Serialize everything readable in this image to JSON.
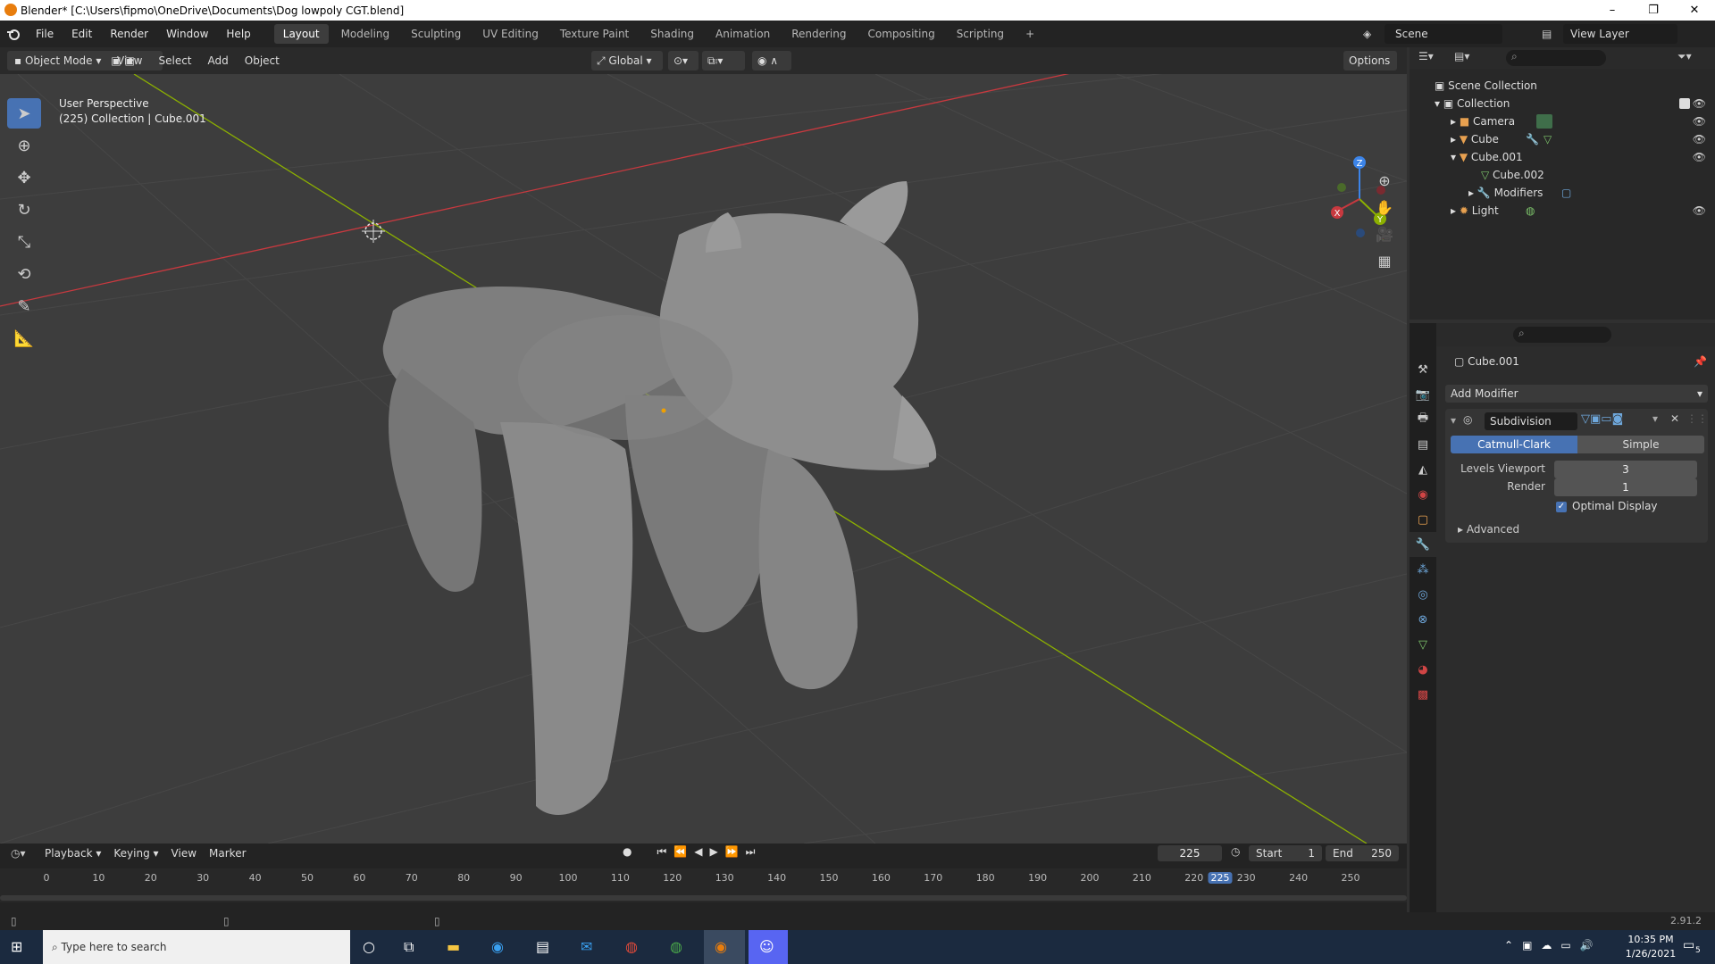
{
  "window": {
    "title": "Blender* [C:\\Users\\fipmo\\OneDrive\\Documents\\Dog lowpoly CGT.blend]",
    "minimize": "–",
    "restore": "❐",
    "close": "✕"
  },
  "menubar": {
    "items": [
      "File",
      "Edit",
      "Render",
      "Window",
      "Help"
    ],
    "workspaces": [
      "Layout",
      "Modeling",
      "Sculpting",
      "UV Editing",
      "Texture Paint",
      "Shading",
      "Animation",
      "Rendering",
      "Compositing",
      "Scripting"
    ],
    "active_workspace": "Layout",
    "add_tab": "+",
    "scene": "Scene",
    "view_layer": "View Layer"
  },
  "viewport_header": {
    "mode": "Object Mode",
    "menus": [
      "View",
      "Select",
      "Add",
      "Object"
    ],
    "transform_orientation": "Global",
    "options": "Options"
  },
  "viewport": {
    "perspective": "User Perspective",
    "collection_info": "(225) Collection | Cube.001",
    "gizmo_axes": [
      "Z",
      "Y",
      "X"
    ]
  },
  "outliner": {
    "root": "Scene Collection",
    "items": [
      {
        "label": "Collection"
      },
      {
        "label": "Camera"
      },
      {
        "label": "Cube"
      },
      {
        "label": "Cube.001"
      },
      {
        "label": "Cube.002"
      },
      {
        "label": "Modifiers"
      },
      {
        "label": "Light"
      }
    ]
  },
  "properties": {
    "object_name": "Cube.001",
    "add_modifier": "Add Modifier",
    "modifier_name": "Subdivision",
    "algorithm_options": [
      "Catmull-Clark",
      "Simple"
    ],
    "active_algorithm": "Catmull-Clark",
    "levels_viewport_label": "Levels Viewport",
    "levels_viewport_value": "3",
    "render_label": "Render",
    "render_value": "1",
    "optimal_display_label": "Optimal Display",
    "optimal_display_checked": true,
    "advanced_label": "Advanced"
  },
  "timeline": {
    "menus": [
      "Playback",
      "Keying",
      "View",
      "Marker"
    ],
    "current_frame": "225",
    "start_label": "Start",
    "start_value": "1",
    "end_label": "End",
    "end_value": "250",
    "ruler_ticks": [
      "0",
      "10",
      "20",
      "30",
      "40",
      "50",
      "60",
      "70",
      "80",
      "90",
      "100",
      "110",
      "120",
      "130",
      "140",
      "150",
      "160",
      "170",
      "180",
      "190",
      "200",
      "210",
      "220",
      "225",
      "230",
      "240",
      "250"
    ]
  },
  "status": {
    "version": "2.91.2"
  },
  "taskbar": {
    "search_placeholder": "Type here to search",
    "time": "10:35 PM",
    "date": "1/26/2021",
    "notification_count": "5"
  },
  "colors": {
    "accent_blue": "#4772b3",
    "x_axis": "#c8393f",
    "y_axis": "#8cb000",
    "z_axis": "#3c84e8",
    "mesh": "#8a8a8a"
  }
}
